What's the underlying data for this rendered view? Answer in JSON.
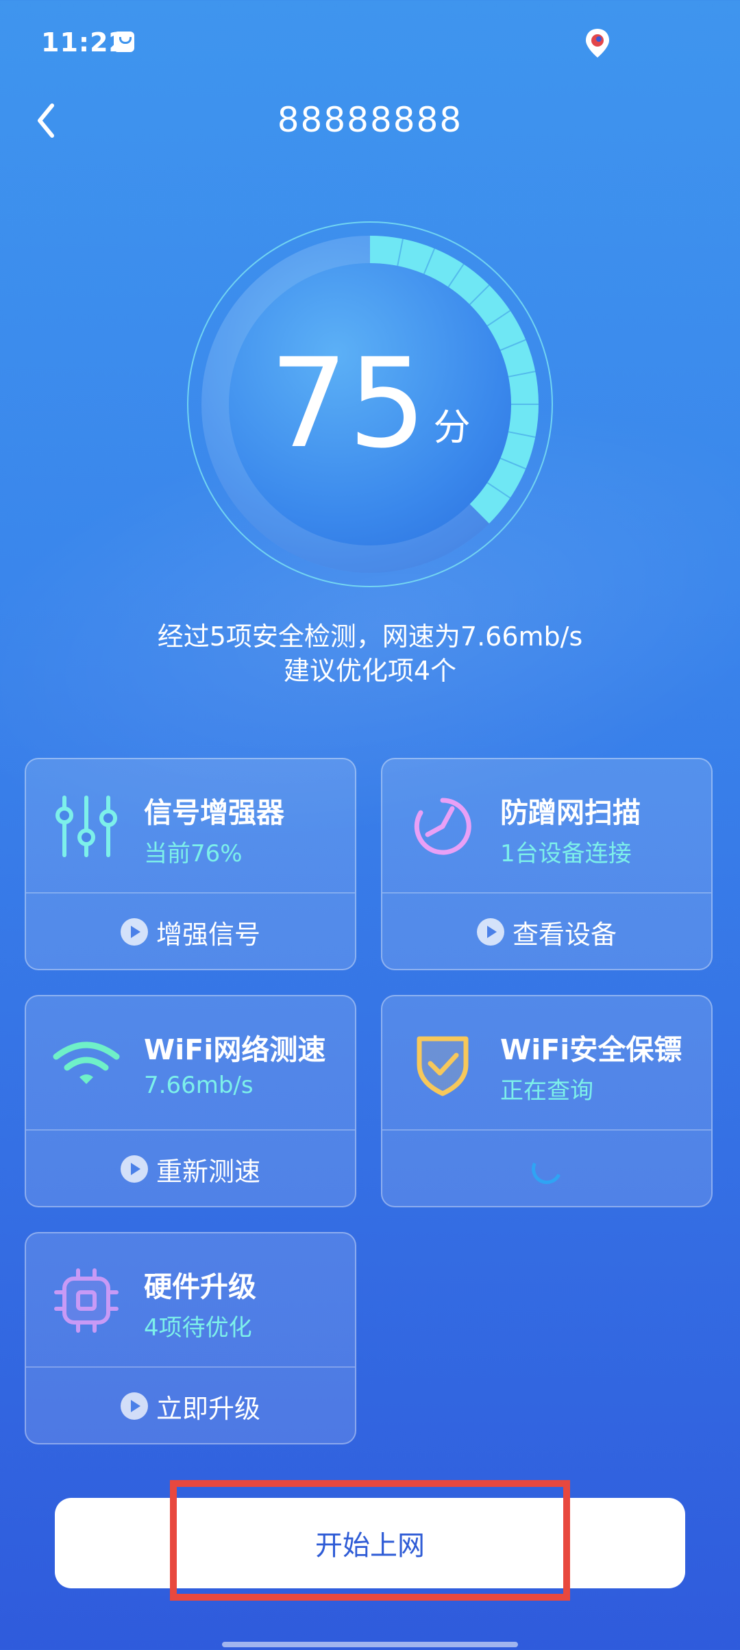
{
  "status_bar": {
    "time": "11:22"
  },
  "header": {
    "title": "88888888"
  },
  "score": {
    "value": "75",
    "unit": "分",
    "fraction": 0.75
  },
  "summary": {
    "line1": "经过5项安全检测，网速为7.66mb/s",
    "line2": "建议优化项4个"
  },
  "cards": [
    {
      "title": "信号增强器",
      "subtitle": "当前76%",
      "action": "增强信号",
      "icon": "equalizer-icon"
    },
    {
      "title": "防蹭网扫描",
      "subtitle": "1台设备连接",
      "action": "查看设备",
      "icon": "scan-gauge-icon"
    },
    {
      "title": "WiFi网络测速",
      "subtitle": "7.66mb/s",
      "action": "重新测速",
      "icon": "wifi-icon"
    },
    {
      "title": "WiFi安全保镖",
      "subtitle": "正在查询",
      "action": "",
      "icon": "shield-check-icon"
    },
    {
      "title": "硬件升级",
      "subtitle": "4项待优化",
      "action": "立即升级",
      "icon": "chip-icon"
    }
  ],
  "cta": {
    "label": "开始上网"
  },
  "colors": {
    "accent_cyan": "#7df0ea",
    "gauge_fill": "#6fe7f4",
    "highlight_red": "#e8483e",
    "cta_text": "#2f5cd6"
  }
}
